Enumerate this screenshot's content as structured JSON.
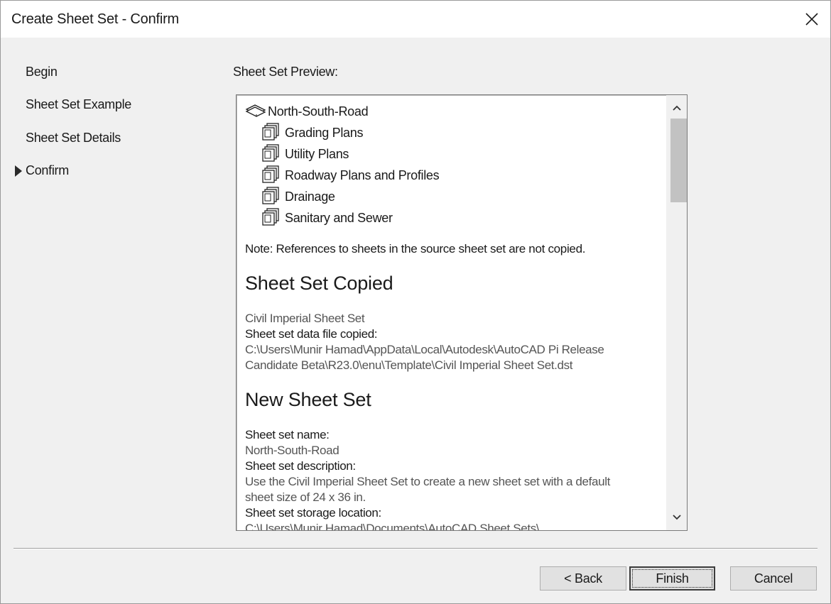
{
  "window": {
    "title": "Create Sheet Set - Confirm",
    "close_icon": "close-icon"
  },
  "steps": [
    {
      "label": "Begin",
      "current": false
    },
    {
      "label": "Sheet Set Example",
      "current": false
    },
    {
      "label": "Sheet Set Details",
      "current": false
    },
    {
      "label": "Confirm",
      "current": true
    }
  ],
  "preview": {
    "label": "Sheet Set Preview:",
    "root": {
      "label": "North-South-Road",
      "icon": "sheet-set-icon"
    },
    "subsets": [
      {
        "label": "Grading Plans",
        "icon": "subset-icon"
      },
      {
        "label": "Utility Plans",
        "icon": "subset-icon"
      },
      {
        "label": "Roadway Plans and Profiles",
        "icon": "subset-icon"
      },
      {
        "label": "Drainage",
        "icon": "subset-icon"
      },
      {
        "label": "Sanitary and Sewer",
        "icon": "subset-icon"
      }
    ],
    "note": "Note: References to sheets in the source sheet set are not copied.",
    "copied": {
      "heading": "Sheet Set Copied",
      "source_name": "Civil Imperial Sheet Set",
      "file_label": "Sheet set data file copied:",
      "file_path_1": "C:\\Users\\Munir Hamad\\AppData\\Local\\Autodesk\\AutoCAD Pi Release",
      "file_path_2": "Candidate Beta\\R23.0\\enu\\Template\\Civil Imperial Sheet Set.dst"
    },
    "new_set": {
      "heading": "New Sheet Set",
      "name_label": "Sheet set name:",
      "name_value": "North-South-Road",
      "desc_label": "Sheet set description:",
      "desc_value_1": "Use the Civil Imperial Sheet Set to create a new sheet set with a default",
      "desc_value_2": "sheet size of 24 x 36 in.",
      "storage_label": "Sheet set storage location:",
      "storage_value": "C:\\Users\\Munir Hamad\\Documents\\AutoCAD Sheet Sets\\"
    }
  },
  "buttons": {
    "back": "< Back",
    "finish": "Finish",
    "cancel": "Cancel"
  }
}
